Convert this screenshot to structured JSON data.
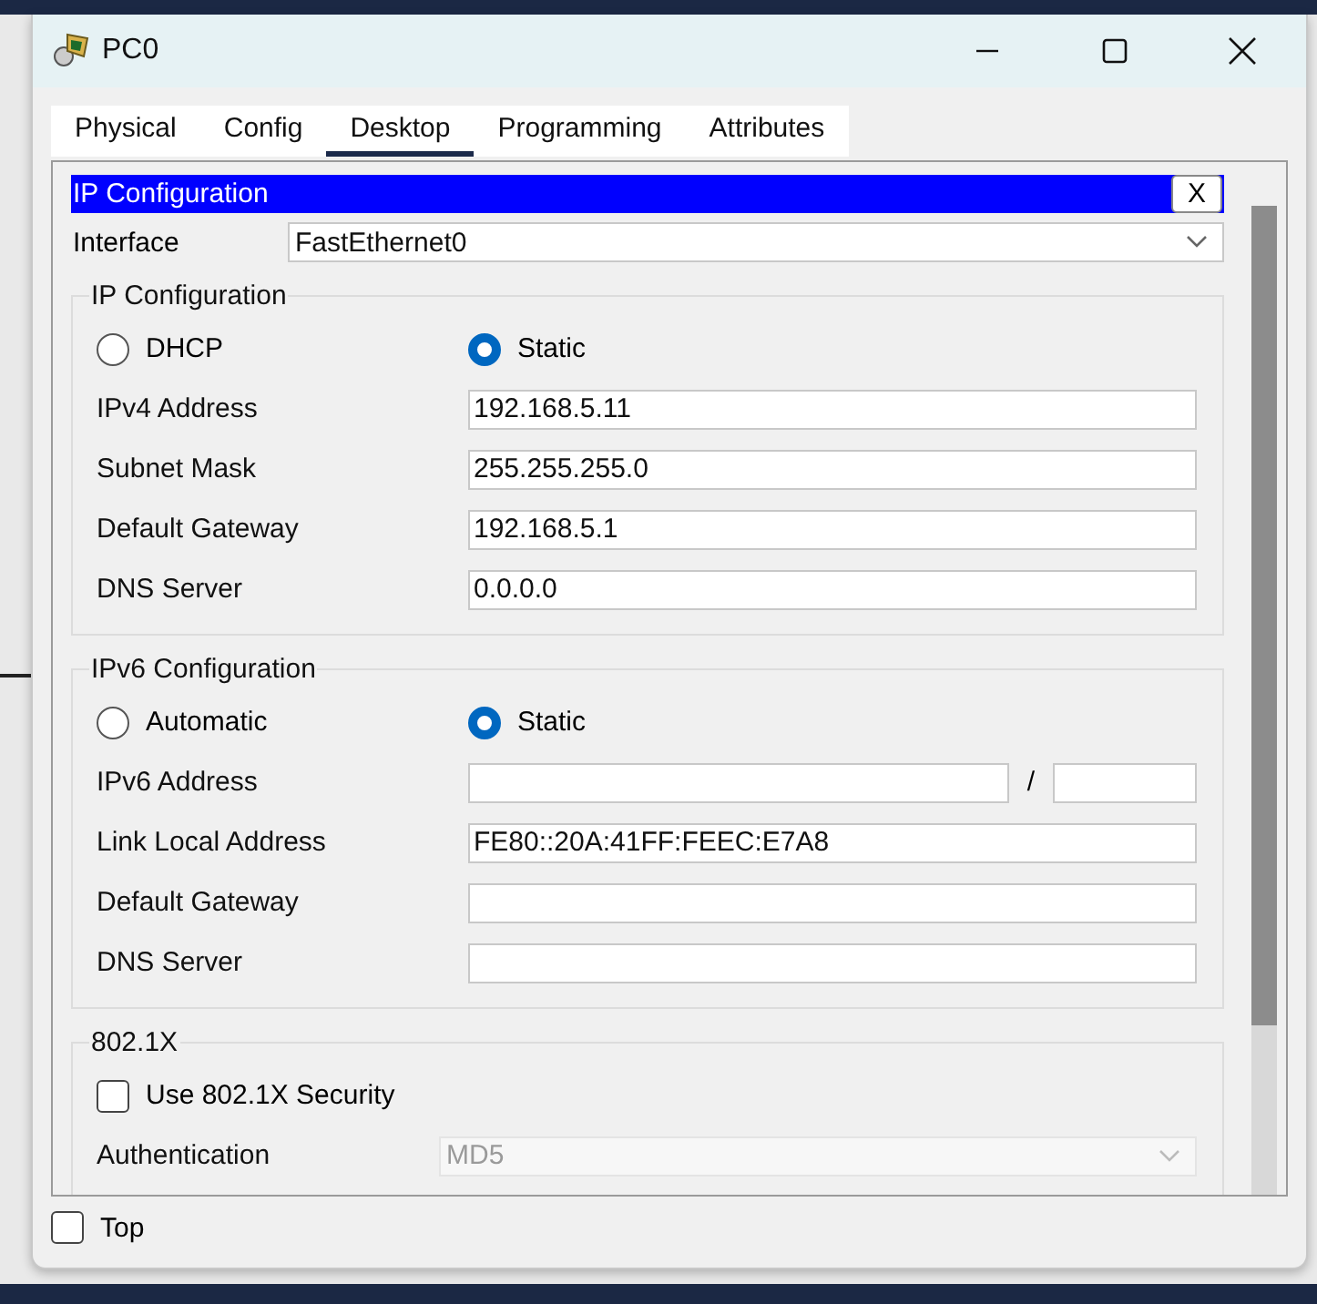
{
  "window": {
    "title": "PC0"
  },
  "tabs": [
    {
      "label": "Physical",
      "selected": false
    },
    {
      "label": "Config",
      "selected": false
    },
    {
      "label": "Desktop",
      "selected": true
    },
    {
      "label": "Programming",
      "selected": false
    },
    {
      "label": "Attributes",
      "selected": false
    }
  ],
  "panel": {
    "title": "IP Configuration",
    "close": "X"
  },
  "interface": {
    "label": "Interface",
    "value": "FastEthernet0"
  },
  "sections": [
    {
      "title": "IP Configuration",
      "rows": [
        {
          "kind": "radio",
          "options": [
            {
              "label": "DHCP",
              "selected": false
            },
            {
              "label": "Static",
              "selected": true
            }
          ]
        },
        {
          "kind": "field",
          "label": "IPv4 Address",
          "value": "192.168.5.11"
        },
        {
          "kind": "field",
          "label": "Subnet Mask",
          "value": "255.255.255.0"
        },
        {
          "kind": "field",
          "label": "Default Gateway",
          "value": "192.168.5.1"
        },
        {
          "kind": "field",
          "label": "DNS Server",
          "value": "0.0.0.0"
        }
      ]
    },
    {
      "title": "IPv6 Configuration",
      "rows": [
        {
          "kind": "radio",
          "options": [
            {
              "label": "Automatic",
              "selected": false
            },
            {
              "label": "Static",
              "selected": true
            }
          ]
        },
        {
          "kind": "prefix",
          "label": "IPv6 Address",
          "separator": "/"
        },
        {
          "kind": "field",
          "label": "Link Local Address",
          "value": "FE80::20A:41FF:FEEC:E7A8"
        },
        {
          "kind": "field",
          "label": "Default Gateway"
        },
        {
          "kind": "field",
          "label": "DNS Server"
        }
      ]
    },
    {
      "title": "802.1X",
      "rows": [
        {
          "kind": "checkbox",
          "label": "Use 802.1X Security",
          "checked": false
        },
        {
          "kind": "select",
          "label": "Authentication",
          "value": "MD5",
          "disabled": true
        }
      ]
    }
  ],
  "top_option": {
    "label": "Top",
    "checked": false
  }
}
